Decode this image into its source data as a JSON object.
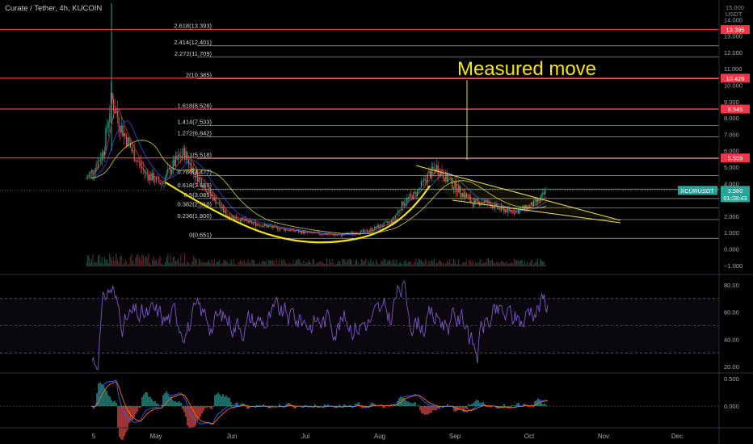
{
  "header": {
    "symbol_title": "Curate / Tether, 4h, KUCOIN",
    "currency_small": "15.000",
    "currency_unit": "USDT"
  },
  "colors": {
    "background": "#000000",
    "red_line": "#f23645",
    "fib_line": "#c9c9c9",
    "yellow": "#f5e500",
    "rsi": "#7e57c2",
    "price_tag": "#26a69a",
    "axis_text": "#a3a6af"
  },
  "annotation": {
    "measured_move": "Measured move"
  },
  "fib_levels": [
    {
      "label": "2.618(13.393)",
      "value": 13.393
    },
    {
      "label": "2.414(12.401)",
      "value": 12.401
    },
    {
      "label": "2.272(11.709)",
      "value": 11.709
    },
    {
      "label": "2(10.385)",
      "value": 10.385
    },
    {
      "label": "1.618(8.526)",
      "value": 8.526
    },
    {
      "label": "1.414(7.533)",
      "value": 7.533
    },
    {
      "label": "1.272(6.842)",
      "value": 6.842
    },
    {
      "label": "1(5.518)",
      "value": 5.518
    },
    {
      "label": "0.786(4.477)",
      "value": 4.477
    },
    {
      "label": "0.618(3.659)",
      "value": 3.659
    },
    {
      "label": "0.5(3.085)",
      "value": 3.085
    },
    {
      "label": "0.382(2.510)",
      "value": 2.51
    },
    {
      "label": "0.236(1.800)",
      "value": 1.8
    },
    {
      "label": "0(0.651)",
      "value": 0.651
    }
  ],
  "red_levels": [
    {
      "label": "13.395",
      "value": 13.395
    },
    {
      "label": "10.426",
      "value": 10.426
    },
    {
      "label": "8.545",
      "value": 8.545
    },
    {
      "label": "5.559",
      "value": 5.559
    }
  ],
  "price_tag": {
    "symbol": "XCURUSDT",
    "price": "3.580",
    "countdown": "01:28:43",
    "value": 3.58
  },
  "price_axis_ticks": [
    {
      "label": "14.000",
      "value": 14
    },
    {
      "label": "13.000",
      "value": 13
    },
    {
      "label": "12.000",
      "value": 12
    },
    {
      "label": "11.000",
      "value": 11
    },
    {
      "label": "10.000",
      "value": 10
    },
    {
      "label": "9.000",
      "value": 9
    },
    {
      "label": "8.000",
      "value": 8
    },
    {
      "label": "7.000",
      "value": 7
    },
    {
      "label": "6.000",
      "value": 6
    },
    {
      "label": "5.000",
      "value": 5
    },
    {
      "label": "4.000",
      "value": 4
    },
    {
      "label": "3.000",
      "value": 3
    },
    {
      "label": "2.000",
      "value": 2
    },
    {
      "label": "1.000",
      "value": 1
    },
    {
      "label": "0.000",
      "value": 0
    },
    {
      "label": "−1.000",
      "value": -1
    }
  ],
  "rsi_ticks": [
    {
      "label": "80.00",
      "value": 80
    },
    {
      "label": "60.00",
      "value": 60
    },
    {
      "label": "40.00",
      "value": 40
    },
    {
      "label": "20.00",
      "value": 20
    }
  ],
  "macd_ticks": [
    {
      "label": "0.500",
      "value": 0.5
    },
    {
      "label": "0.000",
      "value": 0
    }
  ],
  "time_axis": [
    "5",
    "May",
    "Jun",
    "Jul",
    "Aug",
    "Sep",
    "Oct",
    "Nov",
    "Dec"
  ]
}
